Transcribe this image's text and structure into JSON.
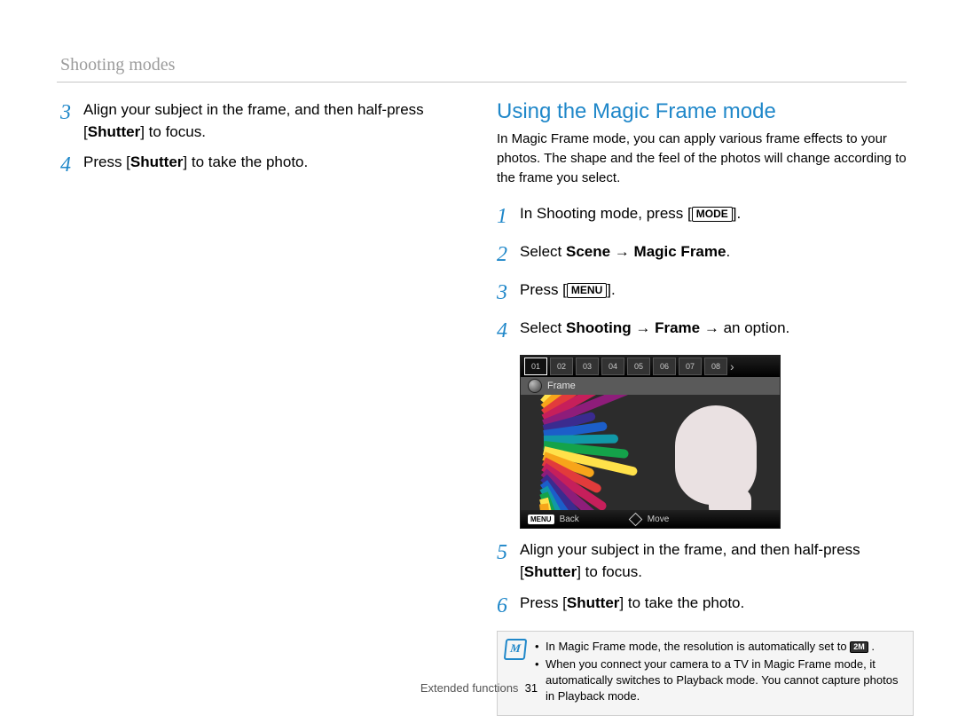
{
  "sectionTitle": "Shooting modes",
  "leftSteps": [
    {
      "num": "3",
      "html": "Align your subject in the frame, and then half-press [<b>Shutter</b>] to focus."
    },
    {
      "num": "4",
      "html": "Press [<b>Shutter</b>] to take the photo."
    }
  ],
  "right": {
    "heading": "Using the Magic Frame mode",
    "intro": "In Magic Frame mode, you can apply various frame effects to your photos. The shape and the feel of the photos will change according to the frame you select.",
    "stepsA": [
      {
        "num": "1",
        "html": "In Shooting mode, press [<span class=\"label-box\">MODE</span>]."
      },
      {
        "num": "2",
        "html": "Select <b>Scene</b> → <b>Magic Frame</b>."
      },
      {
        "num": "3",
        "html": "Press [<span class=\"label-box\">MENU</span>]."
      },
      {
        "num": "4",
        "html": "Select <b>Shooting</b> → <b>Frame</b> → an option."
      }
    ],
    "stepsB": [
      {
        "num": "5",
        "html": "Align your subject in the frame, and then half-press [<b>Shutter</b>] to focus."
      },
      {
        "num": "6",
        "html": "Press [<b>Shutter</b>] to take the photo."
      }
    ]
  },
  "camShot": {
    "barLabel": "Frame",
    "topThumbs": [
      "01",
      "02",
      "03",
      "04",
      "05",
      "06",
      "07",
      "08"
    ],
    "footMenuTag": "MENU",
    "footBack": "Back",
    "footMove": "Move"
  },
  "noteIconLetter": "M",
  "notes": [
    "In Magic Frame mode, the resolution is automatically set to <span class=\"res-chip\">2M</span> .",
    "When you connect your camera to a TV in Magic Frame mode, it automatically switches to Playback mode. You cannot capture photos in Playback mode."
  ],
  "footer": {
    "label": "Extended functions",
    "page": "31"
  }
}
